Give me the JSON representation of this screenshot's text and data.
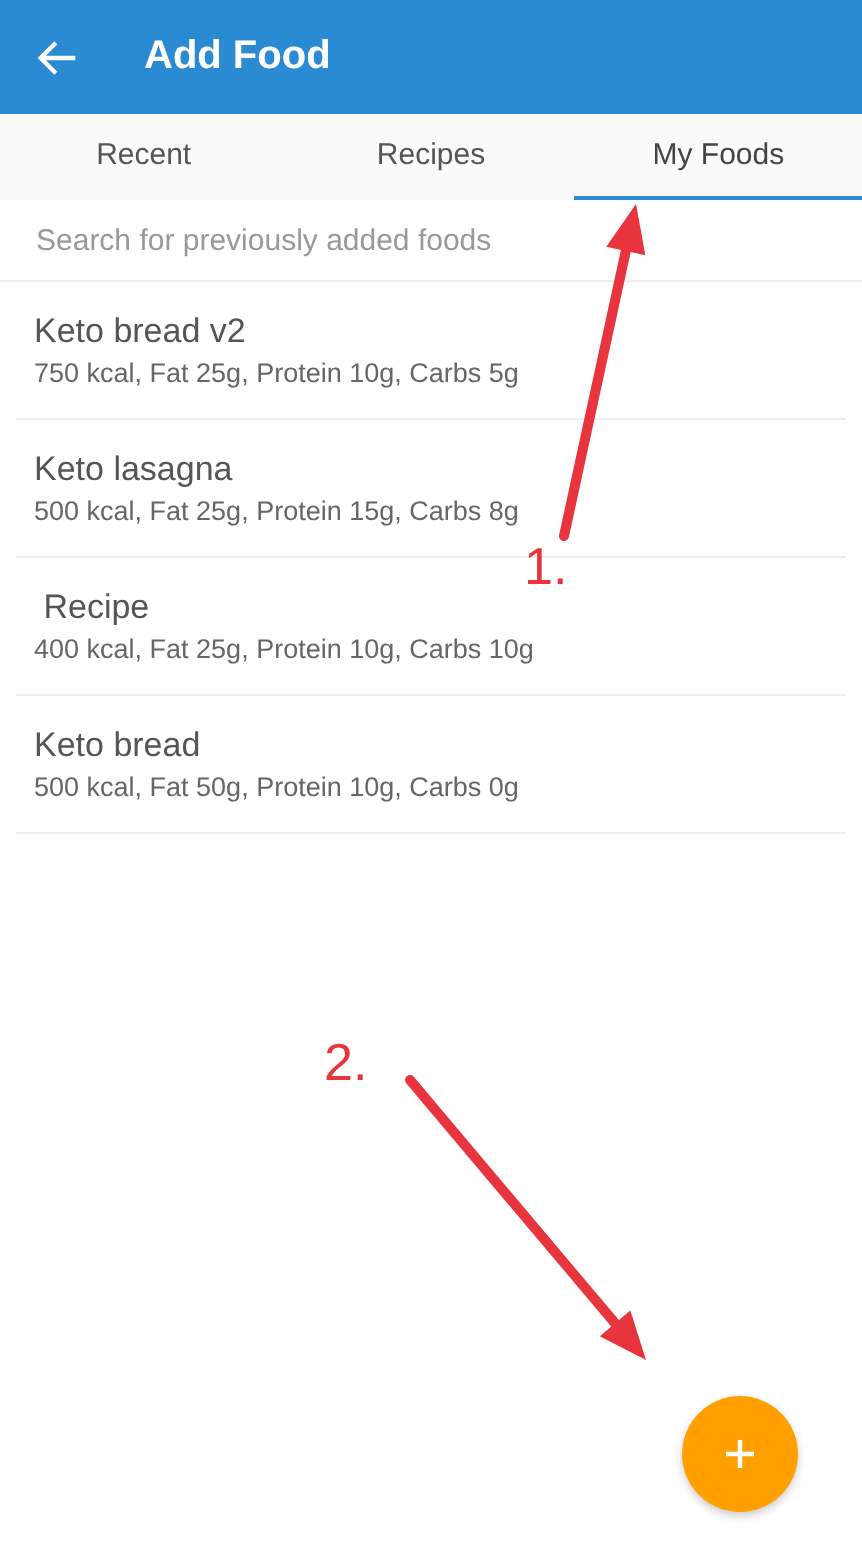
{
  "app_bar": {
    "title": "Add Food"
  },
  "tabs": [
    {
      "label": "Recent",
      "selected": false
    },
    {
      "label": "Recipes",
      "selected": false
    },
    {
      "label": "My Foods",
      "selected": true
    }
  ],
  "search": {
    "placeholder": "Search for previously added foods"
  },
  "foods": [
    {
      "name": "Keto bread v2",
      "details": "750 kcal, Fat 25g, Protein 10g, Carbs 5g"
    },
    {
      "name": "Keto lasagna",
      "details": "500 kcal, Fat 25g, Protein 15g, Carbs 8g"
    },
    {
      "name": " Recipe",
      "details": "400 kcal, Fat 25g, Protein 10g, Carbs 10g"
    },
    {
      "name": "Keto bread",
      "details": "500 kcal, Fat 50g, Protein 10g, Carbs 0g"
    }
  ],
  "annotations": [
    {
      "label": "1."
    },
    {
      "label": "2."
    }
  ]
}
